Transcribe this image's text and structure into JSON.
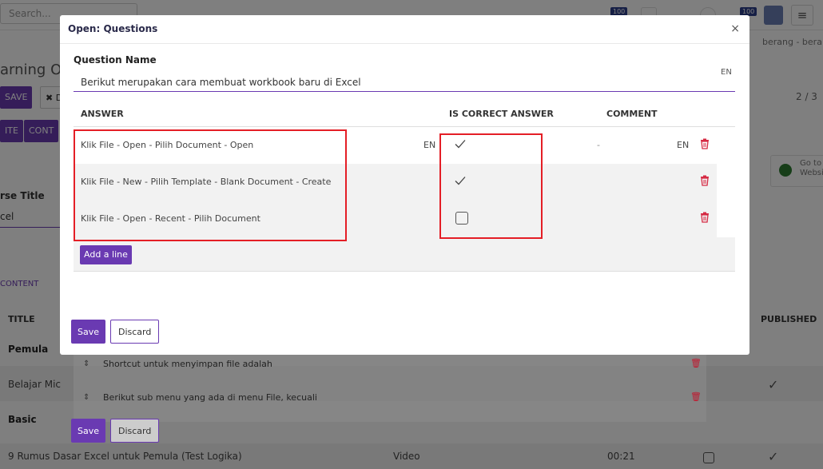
{
  "topbar": {
    "search_placeholder": "Search...",
    "badge_left": "100",
    "badge_right": "100"
  },
  "background": {
    "page_title": "arning Ov",
    "btn_save": "SAVE",
    "btn_discard_partial": "✖ D",
    "btn_invite": "ITE",
    "btn_contact": "CONT",
    "right_text": "berang - berang",
    "pager": "2 / 3",
    "course_title_label": "rse Title",
    "course_title_value": "cel",
    "goto_text": "Go to Website",
    "content_tab": "CONTENT",
    "col_title": "TITLE",
    "col_published": "PUBLISHED",
    "rows": [
      {
        "title": "Pemula",
        "bold": true
      },
      {
        "title": "Belajar Mic",
        "sub": "Shortcut untuk menyimpan file adalah"
      },
      {
        "title": "",
        "sub": "Berikut sub menu yang ada di menu File, kecuali"
      },
      {
        "title": "Basic",
        "bold": true
      },
      {
        "title": "9 Rumus Dasar Excel untuk Pemula (Test Logika)",
        "type": "Video",
        "duration": "00:21"
      }
    ],
    "footer_save": "Save",
    "footer_discard": "Discard"
  },
  "modal": {
    "title": "Open: Questions",
    "close": "×",
    "question_label": "Question Name",
    "question_value": "Berikut merupakan cara membuat workbook baru di Excel",
    "lang": "EN",
    "columns": {
      "answer": "ANSWER",
      "is_correct": "IS CORRECT ANSWER",
      "comment": "COMMENT"
    },
    "answers": [
      {
        "text": "Klik File - Open - Pilih Document - Open",
        "lang": "EN",
        "correct": true,
        "comment": "-",
        "comment_lang": "EN"
      },
      {
        "text": "Klik File - New - Pilih Template - Blank Document - Create",
        "lang": "",
        "correct": true,
        "comment": "",
        "comment_lang": ""
      },
      {
        "text": "Klik File - Open - Recent - Pilih Document",
        "lang": "",
        "correct": false,
        "comment": "",
        "comment_lang": ""
      }
    ],
    "add_line": "Add a line",
    "save": "Save",
    "discard": "Discard"
  },
  "colors": {
    "primary": "#6a3ab2",
    "danger": "#d62b44",
    "highlight": "#e41e26"
  }
}
